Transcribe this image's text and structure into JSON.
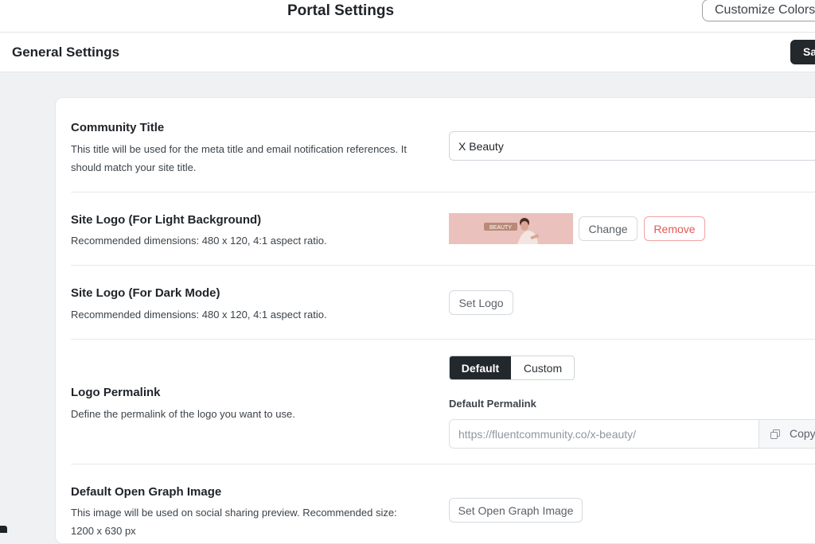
{
  "header": {
    "title": "Portal Settings",
    "customize_label": "Customize Colors"
  },
  "subheader": {
    "title": "General Settings",
    "save_label": "Sa"
  },
  "settings": {
    "community_title": {
      "label": "Community Title",
      "desc_line1": "This title will be used for the meta title and email notification references. It",
      "desc_line2": "should match your site title.",
      "value": "X Beauty"
    },
    "logo_light": {
      "label": "Site Logo (For Light Background)",
      "desc": "Recommended dimensions: 480 x 120, 4:1 aspect ratio.",
      "thumb_text": "BEAUTY",
      "change_label": "Change",
      "remove_label": "Remove"
    },
    "logo_dark": {
      "label": "Site Logo (For Dark Mode)",
      "desc": "Recommended dimensions: 480 x 120, 4:1 aspect ratio.",
      "set_label": "Set Logo"
    },
    "logo_permalink": {
      "label": "Logo Permalink",
      "desc": "Define the permalink of the logo you want to use.",
      "options": [
        "Default",
        "Custom"
      ],
      "selected": "Default",
      "field_label": "Default Permalink",
      "placeholder": "https://fluentcommunity.co/x-beauty/",
      "copy_label": "Copy"
    },
    "og_image": {
      "label": "Default Open Graph Image",
      "desc_line1": "This image will be used on social sharing preview. Recommended size:",
      "desc_line2": "1200 x 630 px",
      "set_label": "Set Open Graph Image"
    }
  },
  "colors": {
    "primary_dark": "#23282d",
    "danger": "#e05a55",
    "logo_bg": "#ebc1bd"
  }
}
